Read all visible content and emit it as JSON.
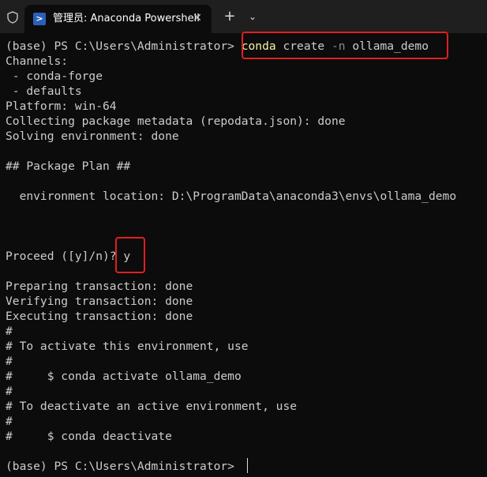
{
  "tab": {
    "title": "管理员: Anaconda Powershell",
    "icon": "powershell-icon",
    "close": "✕"
  },
  "toolbar": {
    "new_tab": "+",
    "dropdown": "⌄"
  },
  "colors": {
    "background": "#0c0c0c",
    "text": "#cccccc",
    "command": "#f9f1a5",
    "highlight": "#e02020"
  },
  "terminal": {
    "prompt": "(base) PS C:\\Users\\Administrator> ",
    "command_name": "conda",
    "command_rest_1": " create ",
    "command_flag": "-n",
    "command_rest_2": " ollama_demo",
    "lines": [
      "Channels:",
      " - conda-forge",
      " - defaults",
      "Platform: win-64",
      "Collecting package metadata (repodata.json): done",
      "Solving environment: done",
      "",
      "## Package Plan ##",
      "",
      "  environment location: D:\\ProgramData\\anaconda3\\envs\\ollama_demo",
      "",
      "",
      "",
      "Proceed ([y]/n)? y",
      "",
      "Preparing transaction: done",
      "Verifying transaction: done",
      "Executing transaction: done",
      "#",
      "# To activate this environment, use",
      "#",
      "#     $ conda activate ollama_demo",
      "#",
      "# To deactivate an active environment, use",
      "#",
      "#     $ conda deactivate",
      "",
      "(base) PS C:\\Users\\Administrator> "
    ]
  }
}
